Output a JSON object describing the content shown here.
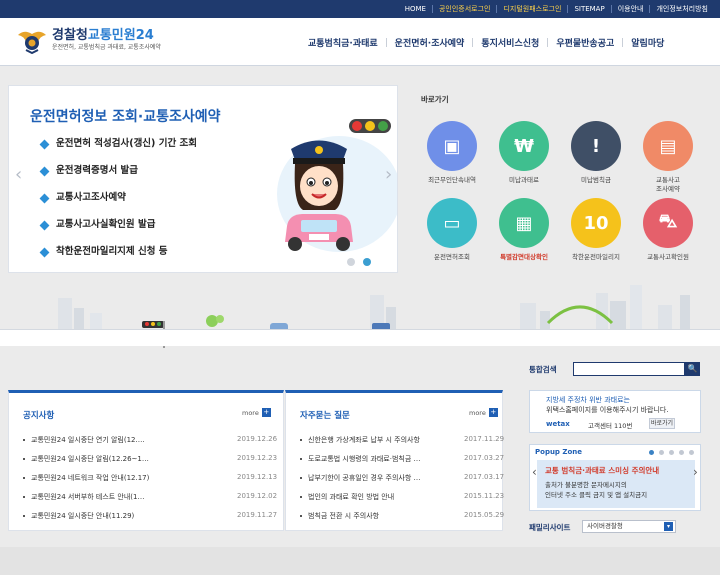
{
  "topbar": {
    "links": [
      {
        "label": "HOME",
        "highlight": false
      },
      {
        "label": "공인인증서로그인",
        "highlight": true
      },
      {
        "label": "디지털원패스로그인",
        "highlight": true
      },
      {
        "label": "SITEMAP",
        "highlight": false
      },
      {
        "label": "이용안내",
        "highlight": false
      },
      {
        "label": "개인정보처리방침",
        "highlight": false
      }
    ]
  },
  "header": {
    "logo_part1": "경찰청",
    "logo_part2": "교통민원24",
    "logo_sub": "운전면허, 교통범칙금 과태료, 교통조사예약",
    "nav": [
      "교통범칙금·과태료",
      "운전면허·조사예약",
      "통지서비스신청",
      "우편물반송공고",
      "알림마당"
    ]
  },
  "banner": {
    "title": "운전면허정보 조회·교통조사예약",
    "items": [
      "운전면허 적성검사(갱신) 기간 조회",
      "운전경력증명서 발급",
      "교통사고조사예약",
      "교통사고사실확인원 발급",
      "착한운전마일리지제 신청 등"
    ],
    "prev_arrow": "‹",
    "next_arrow": "›"
  },
  "quicklinks": {
    "title": "바로가기",
    "items": [
      {
        "label": "최근무인단속내역",
        "icon": "camera-icon",
        "color": "#6f8fe8",
        "glyph": "▣"
      },
      {
        "label": "미납과태료",
        "icon": "money-icon",
        "color": "#3fbf8f",
        "glyph": "₩"
      },
      {
        "label": "미납범칙금",
        "icon": "warning-icon",
        "color": "#3f4f66",
        "glyph": "!"
      },
      {
        "label": "교통사고\n조사예약",
        "icon": "report-icon",
        "color": "#f08a67",
        "glyph": "▤"
      },
      {
        "label": "운전면허조회",
        "icon": "license-icon",
        "color": "#3cbcc8",
        "glyph": "▭"
      },
      {
        "label": "특별감면대상확인",
        "icon": "discount-icon",
        "color": "#3fbf8f",
        "glyph": "▦"
      },
      {
        "label": "착한운전마일리지",
        "icon": "mileage-icon",
        "color": "#f5c21b",
        "glyph": "10"
      },
      {
        "label": "교통사고확인원",
        "icon": "accident-icon",
        "color": "#e5606b",
        "glyph": "⛍"
      }
    ]
  },
  "search": {
    "label": "통합검색",
    "value": "",
    "button_glyph": "🔍"
  },
  "notice": {
    "title": "공지사항",
    "more": "more",
    "rows": [
      {
        "title": "교통민원24 일시중단 연기 알림(12.…",
        "date": "2019.12.26"
      },
      {
        "title": "교통민원24 일시중단 알림(12.26~1…",
        "date": "2019.12.23"
      },
      {
        "title": "교통민원24 네트워크 작업 안내(12.17)",
        "date": "2019.12.13"
      },
      {
        "title": "교통민원24 서버부하 테스트 안내(1…",
        "date": "2019.12.02"
      },
      {
        "title": "교통민원24 일시중단 안내(11.29)",
        "date": "2019.11.27"
      }
    ]
  },
  "faq": {
    "title": "자주묻는 질문",
    "more": "more",
    "rows": [
      {
        "title": "신한은행 가상계좌로 납부 시 주의사항",
        "date": "2017.11.29"
      },
      {
        "title": "도로교통법 시행령의 과태료·범칙금 …",
        "date": "2017.03.27"
      },
      {
        "title": "납부기한이 공휴일인 경우 주의사항 …",
        "date": "2017.03.17"
      },
      {
        "title": "법인의 과태료 확인 방법 안내",
        "date": "2015.11.23"
      },
      {
        "title": "범칙금 전환 시 주의사항",
        "date": "2015.05.29"
      }
    ]
  },
  "ad": {
    "line1": "지방세 주정차 위반 과태료는",
    "line2": "위택스홈페이지를 이용해주시기 바랍니다.",
    "brand": "wetax",
    "center": "고객센터 110번",
    "button": "바로가기"
  },
  "popup": {
    "title": "Popup Zone",
    "inner_title": "교통 범칙금·과태료 스미싱 주의안내",
    "inner_line1": "출처가 불분명한 문자메시지의",
    "inner_line2": "인터넷 주소 클릭 금지 및 앱 설치금지",
    "prev": "‹",
    "next": "›"
  },
  "family": {
    "label": "패밀리사이트",
    "selected": "사이버경찰청"
  },
  "colors": {
    "navy": "#1f3a6e",
    "blue": "#1f5fb4",
    "accent_yellow": "#ffd34a",
    "warning_red": "#d13b2b"
  }
}
